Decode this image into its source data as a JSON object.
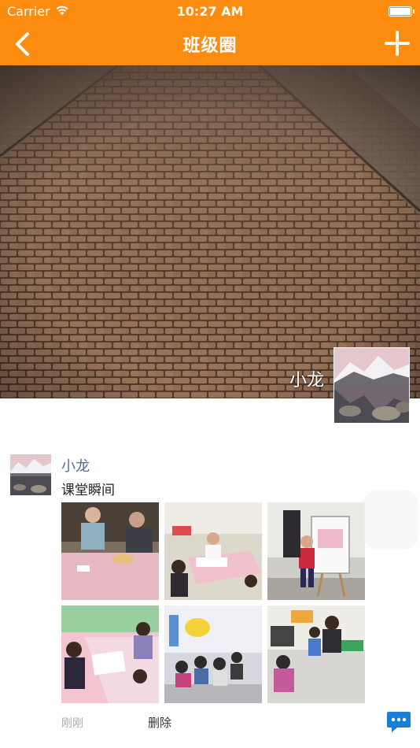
{
  "status_bar": {
    "carrier": "Carrier",
    "time": "10:27 AM"
  },
  "nav": {
    "title": "班级圈",
    "back_icon": "chevron-left-icon",
    "add_icon": "plus-icon"
  },
  "cover": {
    "user_name": "小龙"
  },
  "post": {
    "author": "小龙",
    "text": "课堂瞬间",
    "time": "刚刚",
    "delete_label": "删除",
    "photo_count": 6,
    "comment_icon": "chat-bubble-icon"
  },
  "colors": {
    "accent": "#fb8c0f",
    "author_link": "#576b95",
    "comment_icon": "#1a7ed6"
  }
}
